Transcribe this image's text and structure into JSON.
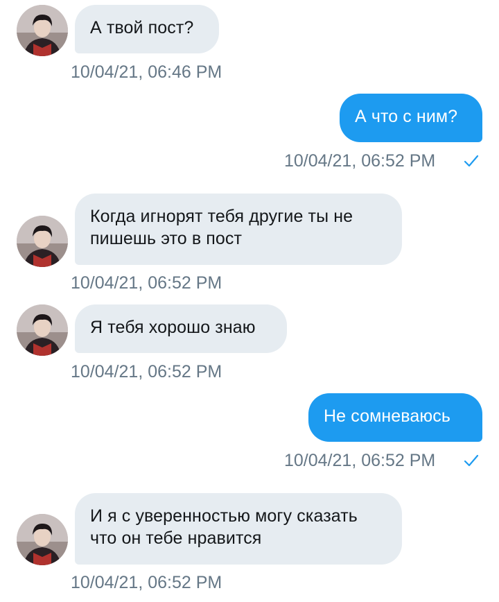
{
  "colors": {
    "incoming_bubble": "#e6ecf1",
    "outgoing_bubble": "#1d9bf0",
    "timestamp_text": "#657786",
    "read_check": "#1d9bf0"
  },
  "messages": [
    {
      "direction": "incoming",
      "avatar_icon": "contact-avatar",
      "text": "А твой пост?",
      "time": "10/04/21, 06:46 PM"
    },
    {
      "direction": "outgoing",
      "text": "А что с ним?",
      "time": "10/04/21, 06:52 PM",
      "status_icon": "check-icon"
    },
    {
      "direction": "incoming",
      "avatar_icon": "contact-avatar",
      "text": "Когда игнорят тебя другие ты не пишешь это в пост",
      "time": "10/04/21, 06:52 PM"
    },
    {
      "direction": "incoming",
      "avatar_icon": "contact-avatar",
      "text": "Я тебя хорошо знаю",
      "time": "10/04/21, 06:52 PM"
    },
    {
      "direction": "outgoing",
      "text": "Не сомневаюсь",
      "time": "10/04/21, 06:52 PM",
      "status_icon": "check-icon"
    },
    {
      "direction": "incoming",
      "avatar_icon": "contact-avatar",
      "text": "И я с уверенностью могу сказать что он тебе нравится",
      "time": "10/04/21, 06:52 PM"
    }
  ]
}
